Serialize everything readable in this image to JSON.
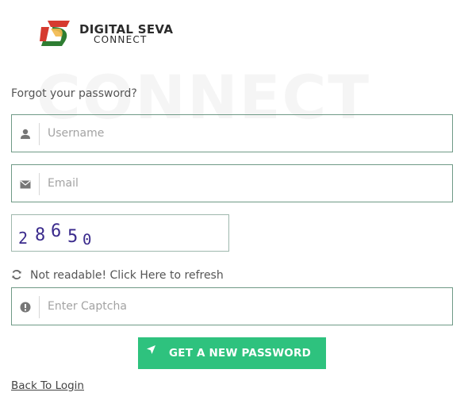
{
  "brand": {
    "line1": "DIGITAL SEVA",
    "line2": "CONNECT",
    "watermark": "CONNECT"
  },
  "form": {
    "heading": "Forgot your password?",
    "username": {
      "placeholder": "Username",
      "value": "",
      "icon": "user-icon"
    },
    "email": {
      "placeholder": "Email",
      "value": "",
      "icon": "envelope-icon"
    },
    "captcha": {
      "digits": [
        "2",
        "8",
        "6",
        "5",
        "0"
      ],
      "color": "#3a2a8c"
    },
    "refresh": {
      "label": "Not readable! Click Here to refresh",
      "icon": "refresh-icon"
    },
    "captcha_input": {
      "placeholder": "Enter Captcha",
      "value": "",
      "icon": "exclamation-circle-icon"
    },
    "submit": {
      "label": "GET A NEW PASSWORD",
      "icon": "location-arrow-icon",
      "color": "#2ec27e"
    },
    "back_link": "Back To Login"
  },
  "colors": {
    "field_border": "#6f9a86",
    "text": "#555555",
    "placeholder": "#a3a3a3"
  }
}
